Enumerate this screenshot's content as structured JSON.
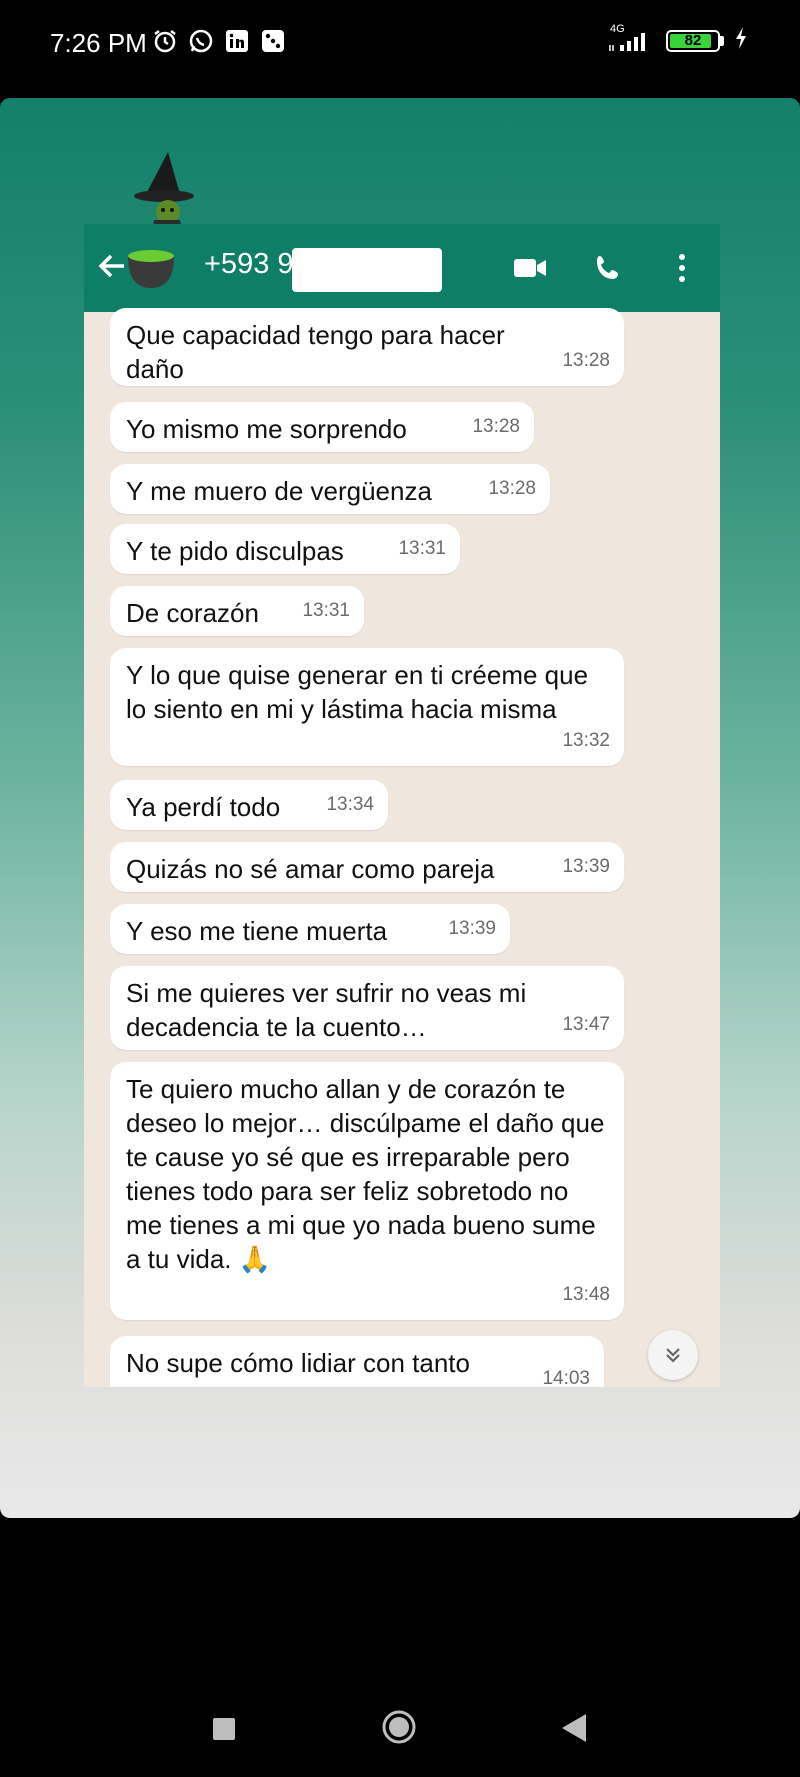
{
  "status_bar": {
    "time": "7:26 PM",
    "network": "4G",
    "battery": "82"
  },
  "header": {
    "contact": "+593 9"
  },
  "messages": [
    {
      "text": "Que capacidad tengo para hacer daño",
      "time": "13:28"
    },
    {
      "text": "Yo mismo me sorprendo",
      "time": "13:28"
    },
    {
      "text": "Y me muero de vergüenza",
      "time": "13:28"
    },
    {
      "text": "Y te pido disculpas",
      "time": "13:31"
    },
    {
      "text": "De corazón",
      "time": "13:31"
    },
    {
      "text": "Y lo que quise generar en ti créeme que lo siento en mi y lástima hacia misma",
      "time": "13:32"
    },
    {
      "text": "Ya perdí todo",
      "time": "13:34"
    },
    {
      "text": "Quizás no sé amar como pareja",
      "time": "13:39"
    },
    {
      "text": "Y eso me tiene muerta",
      "time": "13:39"
    },
    {
      "text": "Si me quieres ver sufrir no veas mi decadencia te la cuento…",
      "time": "13:47"
    },
    {
      "text": "Te quiero mucho allan y de corazón te deseo lo mejor… discúlpame el daño que te cause yo sé que es irreparable pero tienes todo para ser feliz sobretodo no me tienes a mi que yo nada bueno sume a tu vida. 🙏",
      "time": "13:48"
    },
    {
      "text": "No supe cómo lidiar con tanto",
      "time": "14:03"
    }
  ],
  "icons": [
    "alarm-icon",
    "whatsapp-icon",
    "linkedin-icon",
    "dice-icon",
    "signal-icon",
    "battery-icon",
    "charging-icon",
    "back-arrow-icon",
    "video-call-icon",
    "phone-call-icon",
    "more-options-icon",
    "scroll-down-icon",
    "witch-cauldron-sticker",
    "nav-recents-icon",
    "nav-home-icon",
    "nav-back-icon"
  ]
}
